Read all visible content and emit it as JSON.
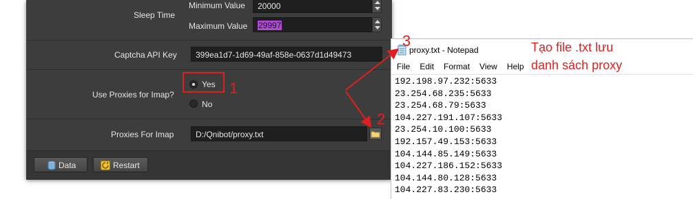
{
  "app": {
    "sleep_time_label": "Sleep Time",
    "min_label": "Minimum Value",
    "min_value": "20000",
    "max_label": "Maximum Value",
    "max_value": "29997",
    "captcha_label": "Captcha API Key",
    "captcha_value": "399ea1d7-1d69-49af-858e-0637d1d49473",
    "use_proxies_label": "Use Proxies for Imap?",
    "yes_label": "Yes",
    "no_label": "No",
    "proxies_label": "Proxies For Imap",
    "proxies_value": "D:/Qnibot/proxy.txt",
    "data_button": "Data",
    "restart_button": "Restart"
  },
  "notepad": {
    "title": "proxy.txt - Notepad",
    "menu": [
      "File",
      "Edit",
      "Format",
      "View",
      "Help"
    ],
    "lines": [
      "192.198.97.232:5633",
      "23.254.68.235:5633",
      "23.254.68.79:5633",
      "104.227.191.107:5633",
      "23.254.10.100:5633",
      "192.157.49.153:5633",
      "104.144.85.149:5633",
      "104.227.186.152:5633",
      "104.144.80.128:5633",
      "104.227.83.230:5633"
    ]
  },
  "annotations": {
    "n1": "1",
    "n2": "2",
    "n3": "3",
    "note_line1": "Tạo file .txt lưu",
    "note_line2": "danh sách proxy",
    "color": "#e02020"
  }
}
